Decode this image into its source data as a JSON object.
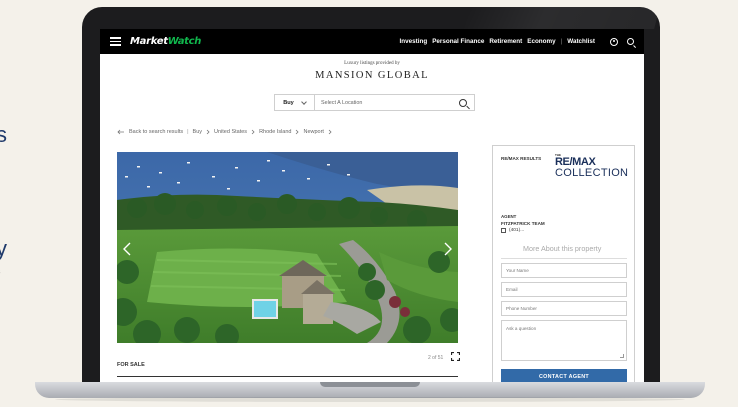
{
  "background": {
    "fragment_1": "s",
    "fragment_2": "y",
    "fragment_3": "s"
  },
  "header": {
    "logo_part1": "Market",
    "logo_part2": "Watch",
    "nav": [
      "Investing",
      "Personal Finance",
      "Retirement",
      "Economy"
    ],
    "separator": "|",
    "watchlist": "Watchlist",
    "icons": [
      "menu-icon",
      "user-icon",
      "search-icon"
    ]
  },
  "listing_source": {
    "provided_by": "Luxury listings provided by",
    "brand": "MANSION GLOBAL"
  },
  "search": {
    "mode": "Buy",
    "placeholder": "Select A Location"
  },
  "breadcrumb": {
    "back": "Back to search results",
    "sep": "|",
    "items": [
      "Buy",
      "United States",
      "Rhode Island",
      "Newport"
    ]
  },
  "gallery": {
    "counter": "2 of 51"
  },
  "listing": {
    "status": "FOR SALE"
  },
  "sidebar": {
    "results_label": "RE/MAX RESULTS",
    "brand_the": "THE",
    "brand_line1": "RE/MAX",
    "brand_line2": "COLLECTION",
    "agent_label": "AGENT",
    "agent_name": "FITZPATRICK TEAM",
    "agent_phone": "(401)...",
    "more_heading": "More About this property",
    "fields": {
      "name": "Your Name",
      "email": "Email",
      "phone": "Phone Number",
      "question": "Ask a question"
    },
    "contact_button": "CONTACT AGENT"
  },
  "colors": {
    "header_bg": "#000000",
    "logo_accent": "#10b74d",
    "button_blue": "#326aa8",
    "remax_navy": "#1a2f5a"
  }
}
